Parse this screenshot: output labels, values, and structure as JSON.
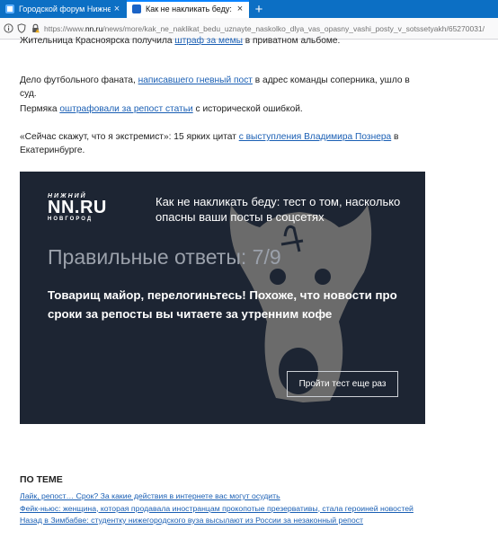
{
  "browser": {
    "tabs": [
      {
        "title": "Городской форум Нижнего Н",
        "active": false
      },
      {
        "title": "Как не накликать беду: тест о",
        "active": true
      }
    ],
    "new_tab_label": "+",
    "close_label": "×",
    "url": {
      "prefix": "https://www.",
      "host": "nn.ru",
      "path": "/news/more/kak_ne_naklikat_bedu_uznayte_naskolko_dlya_vas_opasny_vashi_posty_v_sotssetyakh/65270031/"
    },
    "icons": [
      "info-icon",
      "shield-icon",
      "lock-icon"
    ]
  },
  "article": {
    "cut_line": {
      "before": "Жительница Красноярска получила ",
      "link": "штраф за мемы",
      "after": " в приватном альбоме."
    },
    "paragraphs": [
      {
        "before": "Дело футбольного фаната, ",
        "link": "написавшего гневный пост",
        "after": " в адрес команды соперника, ушло в суд."
      },
      {
        "before": "Пермяка ",
        "link": "оштрафовали за репост статьи",
        "after": " с исторической ошибкой."
      },
      {
        "before": "«Сейчас скажут, что я экстремист»: 15 ярких цитат ",
        "link": "с выступления Владимира Познера",
        "after": " в Екатеринбурге."
      }
    ]
  },
  "quiz": {
    "logo": {
      "line1": "НИЖНИЙ",
      "line2": "NN.RU",
      "line3": "НОВГОРОД"
    },
    "title": "Как не накликать беду: тест о том, насколько опасны ваши посты в соцсетях",
    "score_label": "Правильные ответы:",
    "score_value": "7/9",
    "verdict": "Товарищ майор, перелогиньтесь! Похоже, что новости про сроки за репосты вы читаете за утренним кофе",
    "retry_label": "Пройти тест еще раз",
    "colors": {
      "background": "#1d2533",
      "mascot": "#6b6b6b"
    }
  },
  "on_topic": {
    "heading": "ПО ТЕМЕ",
    "links": [
      "Лайк, репост… Срок? За какие действия в интернете вас могут осудить",
      "Фейк-ньюс: женщина, которая продавала иностранцам прокопотые презервативы, стала героиней новостей",
      "Назад в Зимбабве: студентку нижегородского вуза высылают из России за незаконный репост"
    ]
  },
  "colors": {
    "tab_bar": "#0c6fc4",
    "link": "#1a5fb4"
  }
}
